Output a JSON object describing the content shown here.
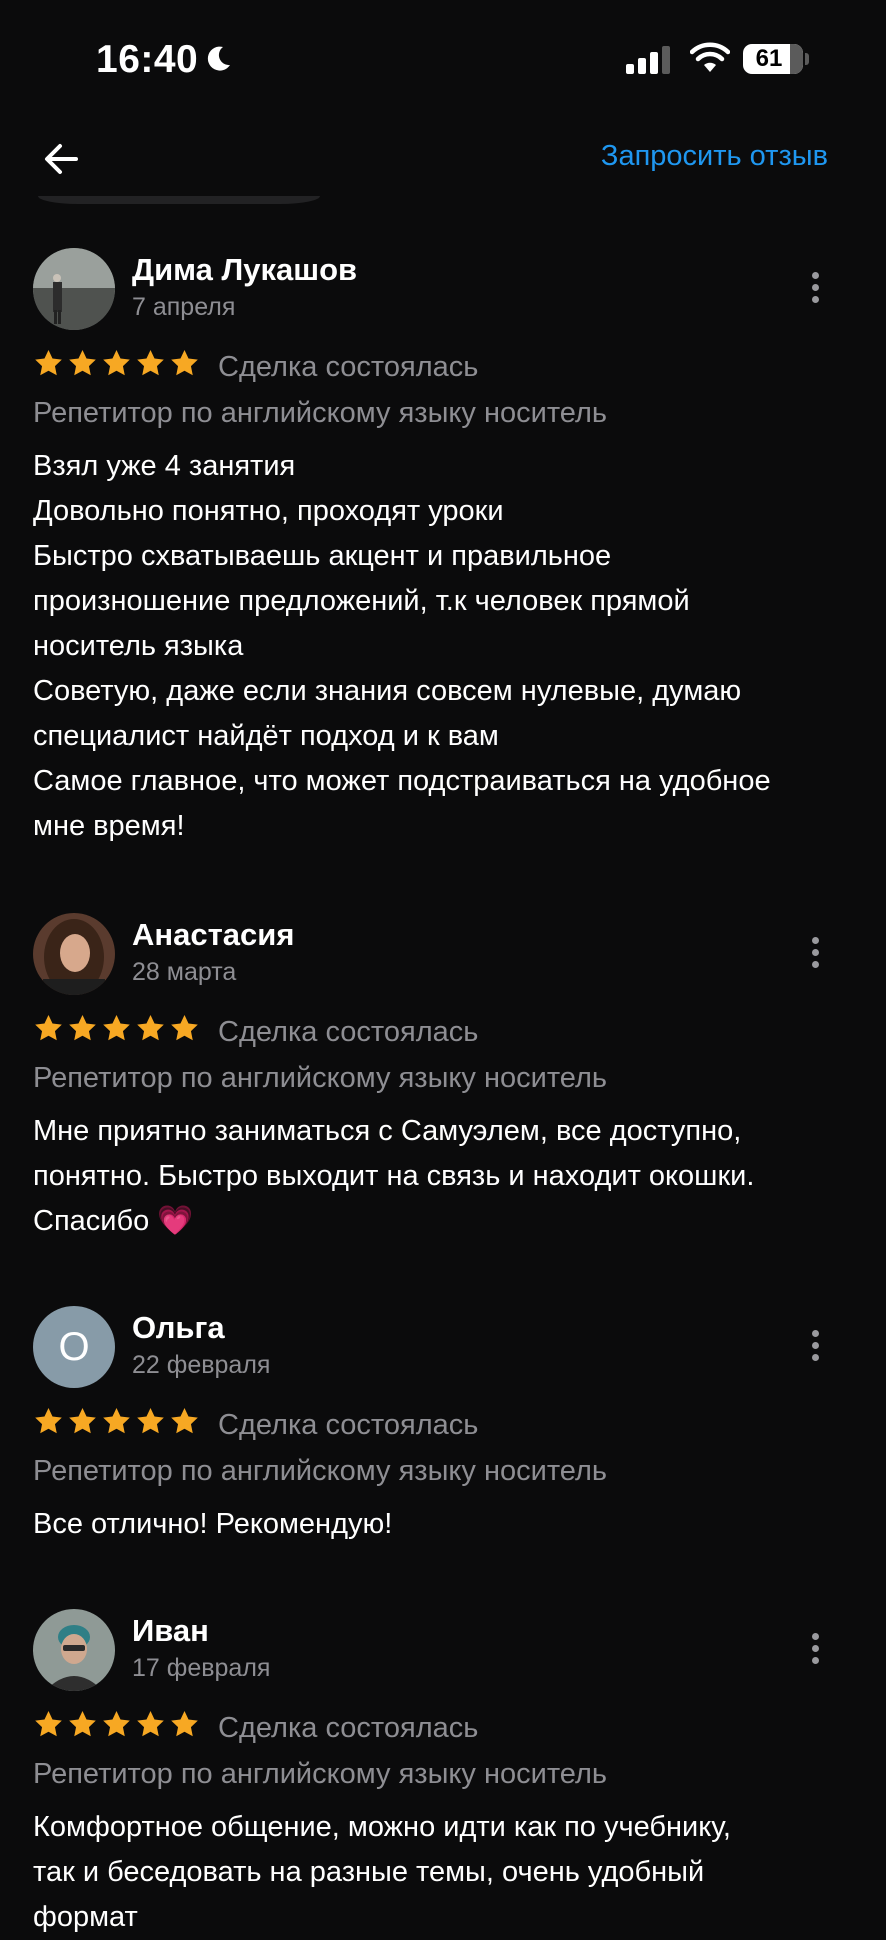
{
  "status_bar": {
    "time": "16:40",
    "battery": "61",
    "icons": [
      "moon-icon",
      "signal-icon",
      "wifi-icon",
      "battery-icon"
    ]
  },
  "nav": {
    "back_icon": "arrow-left-icon",
    "request_review": "Запросить отзыв",
    "accent_color": "#1f97f0"
  },
  "reviews": [
    {
      "author": "Дима Лукашов",
      "date": "7 апреля",
      "rating": 5,
      "deal_status": "Сделка состоялась",
      "service": "Репетитор по английскому языку носитель",
      "text_lines": [
        "Взял уже 4 занятия",
        "Довольно понятно, проходят уроки",
        "Быстро схватываешь акцент и правильное",
        "произношение предложений, т.к человек прямой",
        "носитель языка",
        "Советую, даже если знания совсем нулевые, думаю",
        "специалист найдёт подход и к вам",
        "Самое главное, что может подстраиваться на удобное",
        "мне время!"
      ]
    },
    {
      "author": "Анастасия",
      "date": "28 марта",
      "rating": 5,
      "deal_status": "Сделка состоялась",
      "service": "Репетитор по английскому языку носитель",
      "text_lines": [
        "Мне приятно заниматься с Самуэлем, все доступно,",
        "понятно. Быстро выходит на связь и находит окошки.",
        "Спасибо 💗"
      ]
    },
    {
      "author": "Ольга",
      "avatar_letter": "О",
      "date": "22 февраля",
      "rating": 5,
      "deal_status": "Сделка состоялась",
      "service": "Репетитор по английскому языку носитель",
      "text_lines": [
        "Все отлично! Рекомендую!"
      ]
    },
    {
      "author": "Иван",
      "date": "17 февраля",
      "rating": 5,
      "deal_status": "Сделка состоялась",
      "service": "Репетитор по английскому языку носитель",
      "text_lines": [
        "Комфортное общение, можно идти как по учебнику,",
        "так и  беседовать на разные темы, очень удобный",
        "формат"
      ]
    }
  ],
  "colors": {
    "background": "#0b0b0c",
    "star": "#f7a823",
    "secondary_text": "#8e8e93"
  }
}
